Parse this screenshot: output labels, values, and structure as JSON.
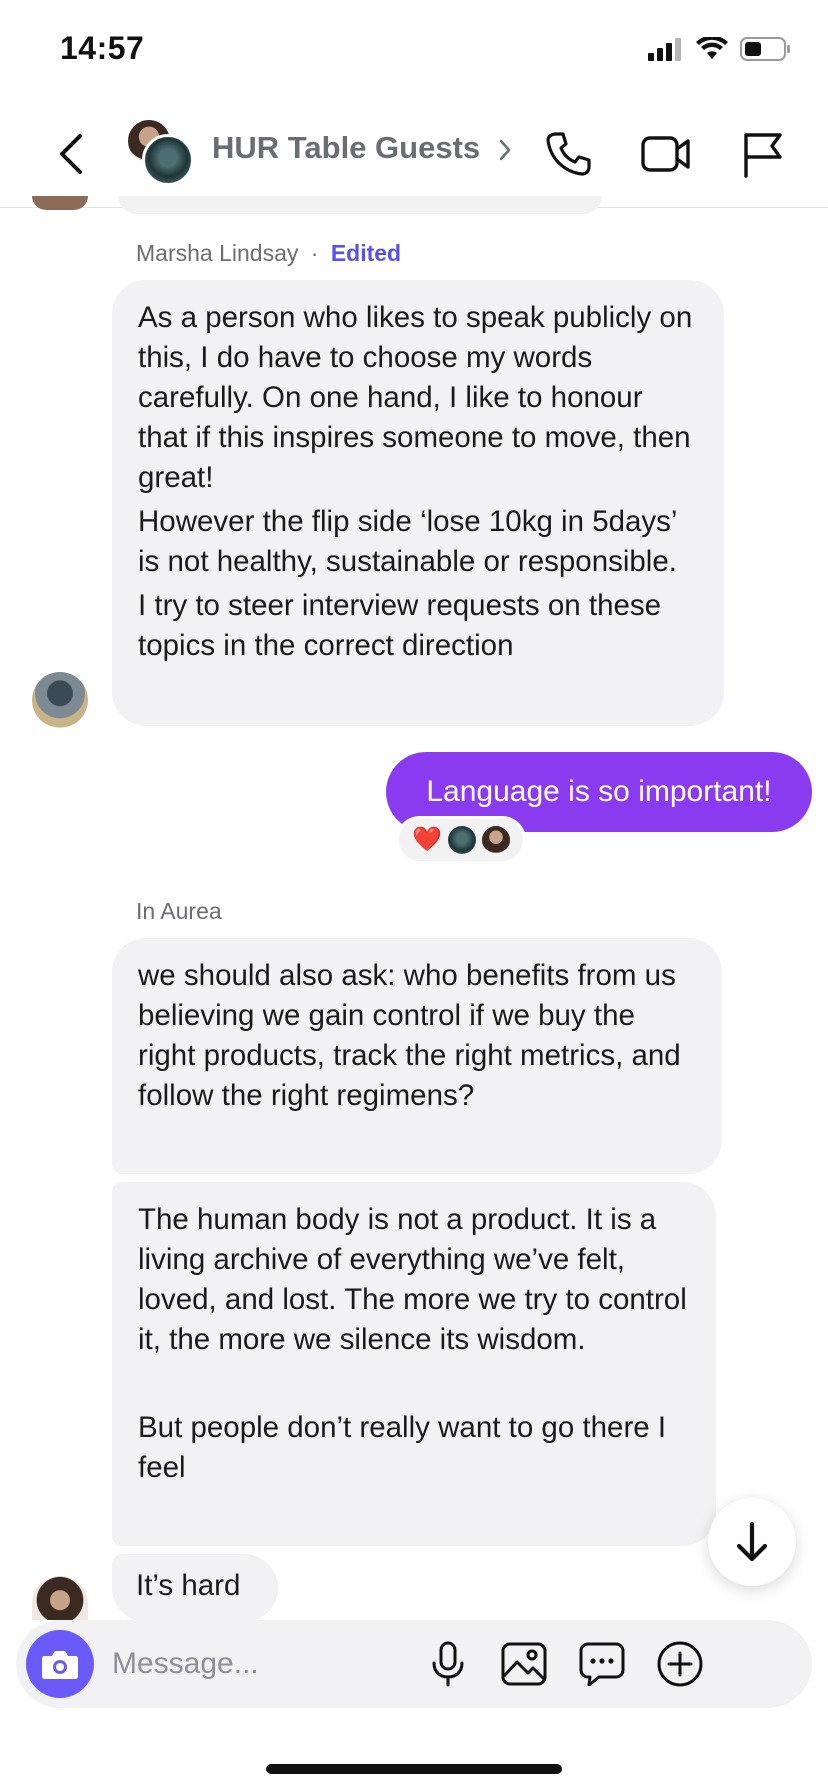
{
  "status_bar": {
    "time": "14:57"
  },
  "header": {
    "title": "HUR Table Guests"
  },
  "messages": {
    "m1": {
      "sender": "Marsha Lindsay",
      "separator": "·",
      "edited_label": "Edited",
      "paragraphs": [
        "As a person who likes to speak publicly on this, I do have to choose my words carefully. On one hand, I like to honour that if this inspires someone to move, then great!",
        "However the flip side ‘lose 10kg in 5days’ is not healthy, sustainable or responsible.",
        "I try to steer interview requests on these topics in the correct direction"
      ]
    },
    "m2": {
      "text": "Language is so important!",
      "reaction_emoji": "❤️"
    },
    "m3": {
      "sender": "In Aurea",
      "text": "we should also ask: who benefits from us believing we gain control if we buy the right products, track the right metrics, and follow the right regimens?"
    },
    "m4": {
      "paragraphs": [
        "The human body is not a product. It is a living archive of everything we’ve felt, loved, and lost. The more we try to control it, the more we silence its wisdom.",
        "But people don’t really want to go there I feel"
      ]
    },
    "m5": {
      "text": "It’s hard"
    }
  },
  "composer": {
    "placeholder": "Message..."
  },
  "colors": {
    "accent": "#8a3bf0",
    "camera": "#6a5af9",
    "edited": "#5a52e6",
    "bubble": "#f2f2f4"
  }
}
